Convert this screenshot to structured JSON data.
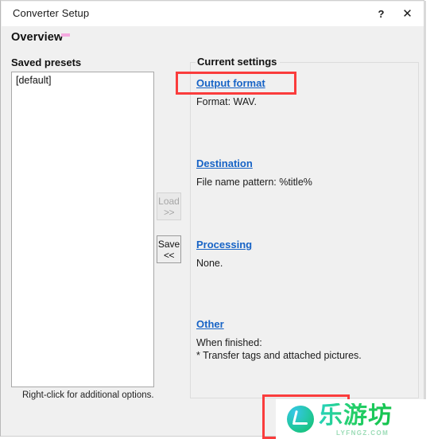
{
  "window": {
    "title": "Converter Setup",
    "help_label": "?",
    "close_label": "✕",
    "page_title": "Overview"
  },
  "presets": {
    "label": "Saved presets",
    "items": [
      "[default]"
    ],
    "hint": "Right-click for additional options."
  },
  "buttons": {
    "load": {
      "line1": "Load",
      "line2": ">>",
      "enabled": false
    },
    "save": {
      "line1": "Save",
      "line2": "<<",
      "enabled": true
    }
  },
  "settings": {
    "legend": "Current settings",
    "sections": [
      {
        "link": "Output format",
        "text": "Format: WAV."
      },
      {
        "link": "Destination",
        "text": "File name pattern: %title%"
      },
      {
        "link": "Processing",
        "text": "None."
      },
      {
        "link": "Other",
        "text": "When finished:\n* Transfer tags and attached pictures."
      }
    ]
  },
  "watermark": {
    "brand": "乐游坊",
    "url": "LYFNGZ.COM"
  },
  "colors": {
    "link": "#1763c6",
    "annotation": "#fa3c3c",
    "window_bg": "#f0f0f0",
    "titlebar_bg": "#ffffff",
    "field_bg": "#ffffff"
  }
}
